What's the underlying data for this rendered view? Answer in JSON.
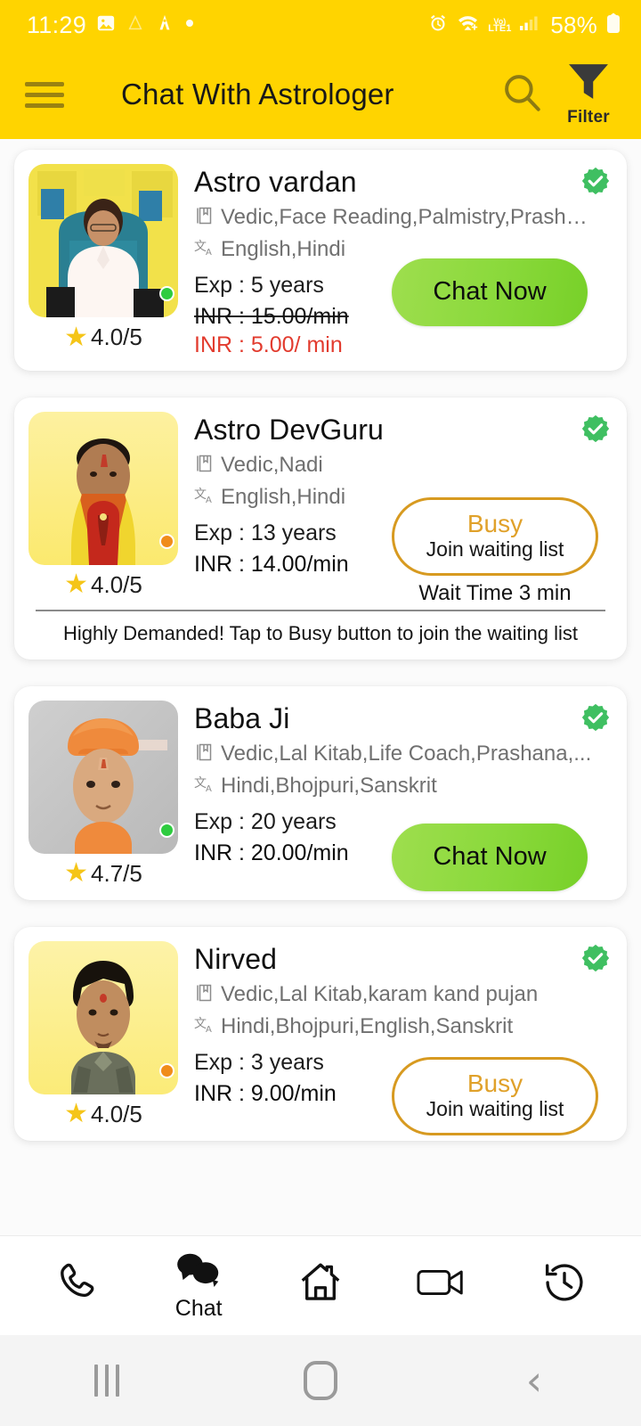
{
  "status_bar": {
    "time": "11:29",
    "battery": "58%",
    "network_label": "LTE1",
    "volte_label": "VoLTE",
    "icons": [
      "photo-icon",
      "app-icon",
      "app-icon-2",
      "dot-icon",
      "alarm-icon",
      "wifi-icon",
      "volte-icon",
      "signal-icon",
      "battery-icon"
    ]
  },
  "header": {
    "title": "Chat With Astrologer",
    "menu_icon": "hamburger-menu-icon",
    "search_icon": "search-icon",
    "filter_icon": "filter-funnel-icon",
    "filter_label": "Filter",
    "background_color": "#FFD400"
  },
  "colors": {
    "brand_yellow": "#FFD400",
    "chat_green": "#8ad93b",
    "busy_amber": "#E0A12A",
    "discount_red": "#E23B2E",
    "verified_green": "#3FBF61",
    "star_yellow": "#F5C518",
    "online_dot": "#2ecc3f",
    "busy_dot": "#f08c1a"
  },
  "astrologers": [
    {
      "name": "Astro vardan",
      "skills": "Vedic,Face Reading,Palmistry,Prasha...",
      "languages": "English,Hindi",
      "experience": "Exp : 5 years",
      "price_original": "INR : 15.00/min",
      "price_discounted": "INR : 5.00/ min",
      "has_discount": true,
      "rating": "4.0/5",
      "verified": true,
      "status": "online",
      "action": "chat",
      "action_label": "Chat Now"
    },
    {
      "name": "Astro DevGuru",
      "skills": "Vedic,Nadi",
      "languages": "English,Hindi",
      "experience": "Exp : 13 years",
      "price_original": "INR : 14.00/min",
      "price_discounted": "",
      "has_discount": false,
      "rating": "4.0/5",
      "verified": true,
      "status": "busy",
      "action": "busy",
      "action_label": "Busy",
      "action_sub_label": "Join waiting list",
      "wait_time": "Wait Time 3 min",
      "promo_text": "Highly Demanded! Tap to Busy button to join the waiting list"
    },
    {
      "name": "Baba Ji",
      "skills": "Vedic,Lal Kitab,Life Coach,Prashana,...",
      "languages": "Hindi,Bhojpuri,Sanskrit",
      "experience": "Exp : 20 years",
      "price_original": "INR : 20.00/min",
      "price_discounted": "",
      "has_discount": false,
      "rating": "4.7/5",
      "verified": true,
      "status": "online",
      "action": "chat",
      "action_label": "Chat Now"
    },
    {
      "name": "Nirved",
      "skills": "Vedic,Lal Kitab,karam kand pujan",
      "languages": "Hindi,Bhojpuri,English,Sanskrit",
      "experience": "Exp : 3 years",
      "price_original": "INR : 9.00/min",
      "price_discounted": "",
      "has_discount": false,
      "rating": "4.0/5",
      "verified": true,
      "status": "busy",
      "action": "busy",
      "action_label": "Busy",
      "action_sub_label": "Join waiting list",
      "wait_time": "",
      "promo_text": ""
    }
  ],
  "bottom_nav": {
    "items": [
      {
        "icon": "phone-call-icon",
        "label": ""
      },
      {
        "icon": "chat-bubbles-icon",
        "label": "Chat"
      },
      {
        "icon": "home-icon",
        "label": ""
      },
      {
        "icon": "video-camera-icon",
        "label": ""
      },
      {
        "icon": "history-clock-icon",
        "label": ""
      }
    ]
  },
  "android_nav": {
    "recents_icon": "recents-icon",
    "home_icon": "home-button-icon",
    "back_icon": "back-chevron-icon"
  }
}
